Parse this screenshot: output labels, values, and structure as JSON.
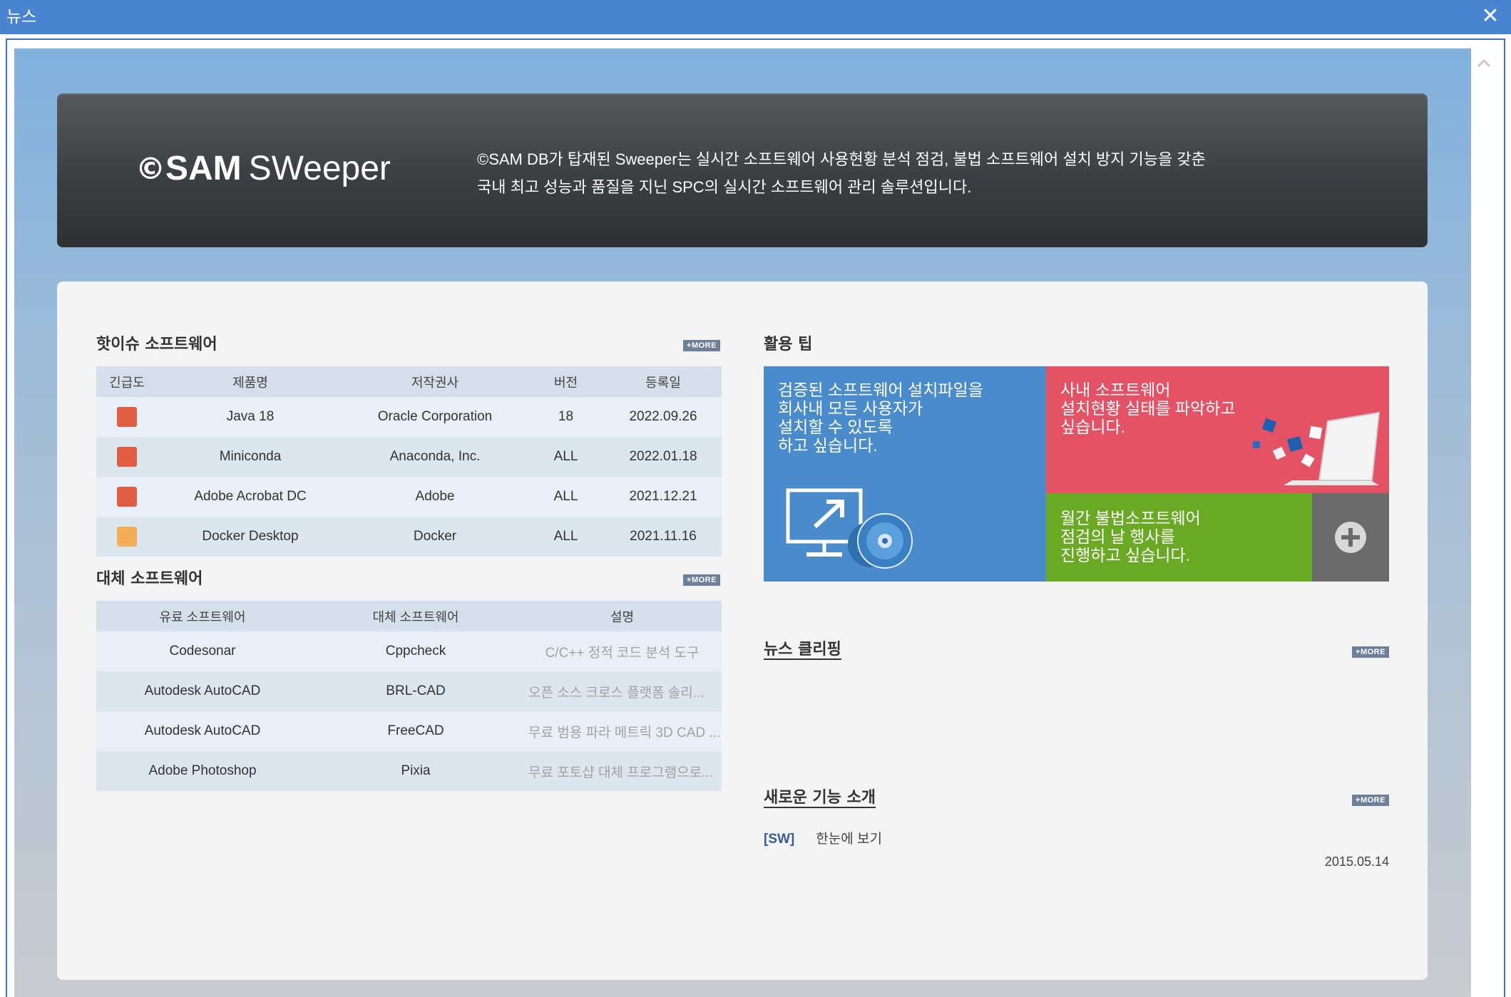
{
  "window": {
    "title": "뉴스",
    "close_label": "✕"
  },
  "banner": {
    "logo_symbol": "©",
    "logo_sam": "SAM",
    "logo_sweeper": "SWeeper",
    "description_line1": "©SAM DB가 탑재된 Sweeper는 실시간 소프트웨어 사용현황 분석 점검, 불법 소프트웨어 설치 방지 기능을 갖춘",
    "description_line2": "국내 최고 성능과 품질을 지닌 SPC의 실시간 소프트웨어 관리 솔루션입니다."
  },
  "more_label": "+MORE",
  "hot_issue": {
    "title": "핫이슈 소프트웨어",
    "headers": [
      "긴급도",
      "제품명",
      "저작권사",
      "버전",
      "등록일"
    ],
    "rows": [
      {
        "urgency_color": "#e05f42",
        "product": "Java 18",
        "publisher": "Oracle Corporation",
        "version": "18",
        "date": "2022.09.26"
      },
      {
        "urgency_color": "#e05f42",
        "product": "Miniconda",
        "publisher": "Anaconda, Inc.",
        "version": "ALL",
        "date": "2022.01.18"
      },
      {
        "urgency_color": "#e05f42",
        "product": "Adobe Acrobat DC",
        "publisher": "Adobe",
        "version": "ALL",
        "date": "2021.12.21"
      },
      {
        "urgency_color": "#f3ad58",
        "product": "Docker Desktop",
        "publisher": "Docker",
        "version": "ALL",
        "date": "2021.11.16"
      }
    ]
  },
  "alternative": {
    "title": "대체 소프트웨어",
    "headers": [
      "유료 소프트웨어",
      "대체 소프트웨어",
      "설명"
    ],
    "rows": [
      {
        "paid": "Codesonar",
        "alt": "Cppcheck",
        "desc": "C/C++ 정적 코드 분석 도구"
      },
      {
        "paid": "Autodesk AutoCAD",
        "alt": "BRL-CAD",
        "desc": "오픈 소스 크로스 플랫폼 솔리..."
      },
      {
        "paid": "Autodesk AutoCAD",
        "alt": "FreeCAD",
        "desc": "무료 범용 파라 메트릭 3D CAD ..."
      },
      {
        "paid": "Adobe Photoshop",
        "alt": "Pixia",
        "desc": "무료 포토샵 대체 프로그램으로..."
      }
    ]
  },
  "tips": {
    "title": "활용 팁",
    "tile_blue": "검증된 소프트웨어 설치파일을\n회사내 모든 사용자가\n설치할 수 있도록\n하고 싶습니다.",
    "tile_red": "사내 소프트웨어\n설치현황 실태를 파악하고\n싶습니다.",
    "tile_green": "월간 불법소프트웨어\n점검의 날 행사를\n진행하고 싶습니다.",
    "colors": {
      "blue": "#4a8bcb",
      "red": "#e45266",
      "green": "#6aa923",
      "gray": "#6b6b6b"
    }
  },
  "news_clipping": {
    "title": "뉴스 클리핑"
  },
  "new_features": {
    "title": "새로운 기능 소개",
    "items": [
      {
        "tag": "[SW]",
        "title": "한눈에 보기",
        "date": "2015.05.14"
      }
    ]
  }
}
